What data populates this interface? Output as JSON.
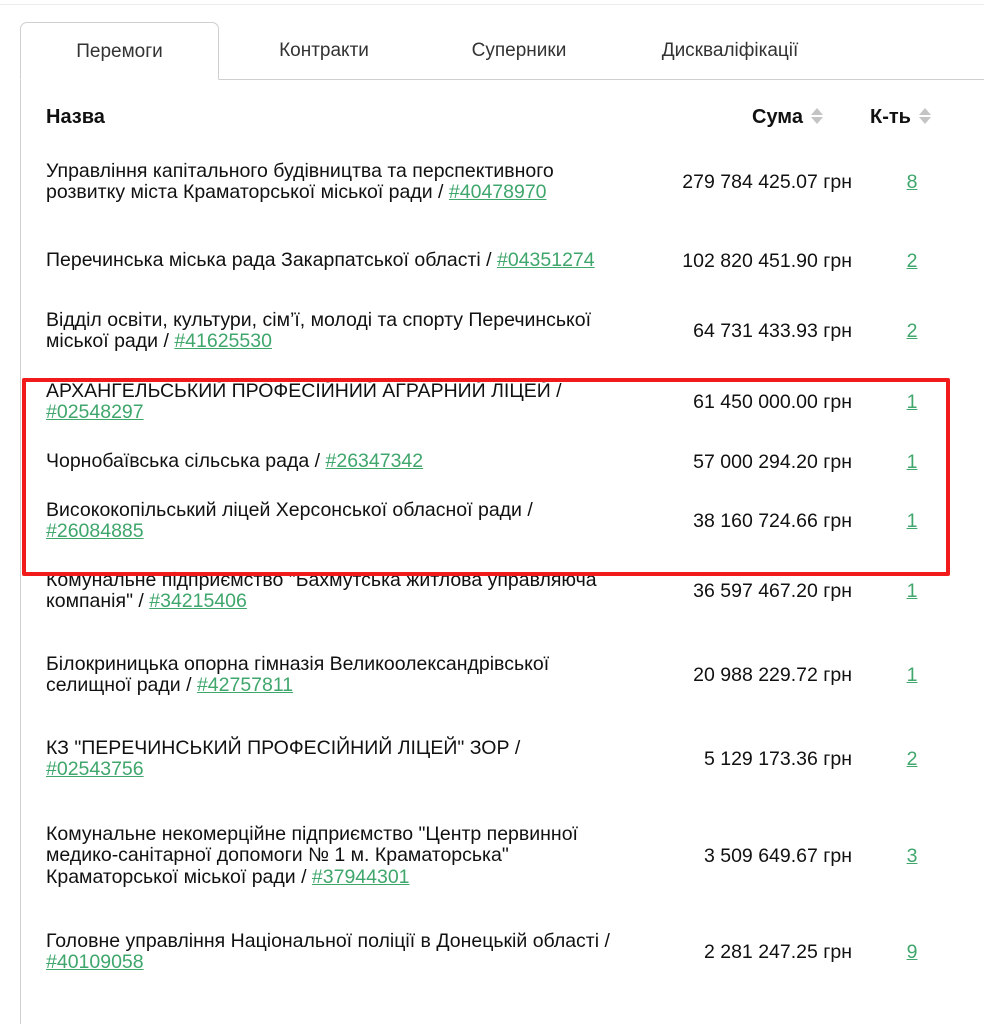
{
  "tabs": [
    {
      "label": "Перемоги",
      "active": true
    },
    {
      "label": "Контракти",
      "active": false
    },
    {
      "label": "Суперники",
      "active": false
    },
    {
      "label": "Дискваліфікації",
      "active": false
    }
  ],
  "table": {
    "headers": {
      "name": "Назва",
      "sum": "Сума",
      "count": "К-ть"
    },
    "rows": [
      {
        "name": "Управління капітального будівництва та перспективного розвитку міста Краматорської міської ради",
        "code": "#40478970",
        "sum": "279 784 425.07 грн",
        "count": "8"
      },
      {
        "name": "Перечинська міська рада Закарпатської області",
        "code": "#04351274",
        "sum": "102 820 451.90 грн",
        "count": "2"
      },
      {
        "name": "Відділ освіти, культури, сім’ї, молоді та спорту Перечинської міської ради",
        "code": "#41625530",
        "sum": "64 731 433.93 грн",
        "count": "2"
      },
      {
        "name": "АРХАНГЕЛЬСЬКИЙ ПРОФЕСІЙНИЙ АГРАРНИЙ ЛІЦЕЙ",
        "code": "#02548297",
        "sum": "61 450 000.00 грн",
        "count": "1"
      },
      {
        "name": "Чорнобаївська сільська рада",
        "code": "#26347342",
        "sum": "57 000 294.20 грн",
        "count": "1"
      },
      {
        "name": "Висококопільський ліцей Херсонської обласної ради",
        "code": "#26084885",
        "sum": "38 160 724.66 грн",
        "count": "1"
      },
      {
        "name": "Комунальне підприємство \"Бахмутська житлова управляюча компанія\"",
        "code": "#34215406",
        "sum": "36 597 467.20 грн",
        "count": "1"
      },
      {
        "name": "Білокриницька опорна гімназія Великоолександрівської селищної ради",
        "code": "#42757811",
        "sum": "20 988 229.72 грн",
        "count": "1"
      },
      {
        "name": "КЗ \"ПЕРЕЧИНСЬКИЙ ПРОФЕСІЙНИЙ ЛІЦЕЙ\" ЗОР",
        "code": "#02543756",
        "sum": "5 129 173.36 грн",
        "count": "2"
      },
      {
        "name": "Комунальне некомерційне підприємство \"Центр первинної медико-санітарної допомоги № 1 м. Краматорська\" Краматорської міської ради",
        "code": "#37944301",
        "sum": "3 509 649.67 грн",
        "count": "3"
      },
      {
        "name": "Головне управління Національної поліції в Донецькій області",
        "code": "#40109058",
        "sum": "2 281 247.25 грн",
        "count": "9"
      }
    ]
  },
  "colors": {
    "link": "#3fa66c",
    "highlight": "#f21b1b",
    "border": "#cfcfcf"
  },
  "icons": {
    "sort": "sort-up-down-icon"
  }
}
